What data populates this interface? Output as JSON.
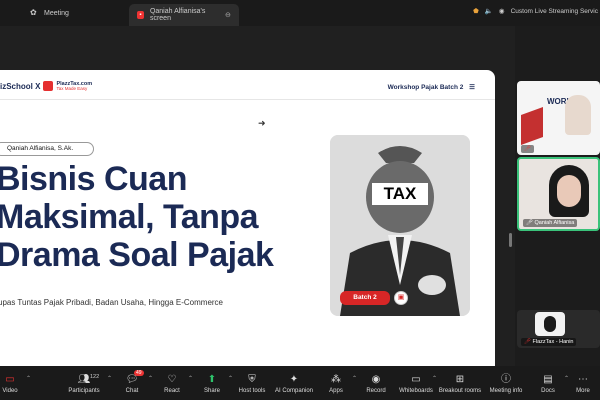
{
  "window": {
    "tabs": [
      {
        "label": "Meeting"
      },
      {
        "label": "Qaniah Alfianisa's screen"
      }
    ],
    "streaming_label": "Custom Live Streaming Servic"
  },
  "slide": {
    "brand": "izSchool X",
    "brand_partner": "PlazzTax.com",
    "brand_tagline": "Tax Made Easy",
    "workshop_label": "Workshop Pajak Batch 2",
    "speaker": "Qaniah Alfianisa, S.Ak.",
    "headline": [
      "Bisnis Cuan",
      "Maksimal, Tanpa",
      "Drama Soal Pajak"
    ],
    "tagline": "upas Tuntas Pajak Pribadi, Badan Usaha, Hingga E-Commerce",
    "tax_bag_label": "TAX",
    "batch_label": "Batch 2"
  },
  "participants_panel": {
    "tiles": [
      {
        "name": "",
        "top_label": "WORK"
      },
      {
        "name": "Qaniah Alfianisa"
      },
      {
        "name": "FlazzTax - Hanin"
      }
    ]
  },
  "toolbar": {
    "items": [
      {
        "label": "Video",
        "icon": "video-off-icon"
      },
      {
        "label": "Participants",
        "icon": "participants-icon",
        "count": "122"
      },
      {
        "label": "Chat",
        "icon": "chat-icon",
        "badge": "49"
      },
      {
        "label": "React",
        "icon": "react-icon"
      },
      {
        "label": "Share",
        "icon": "share-icon"
      },
      {
        "label": "Host tools",
        "icon": "shield-icon"
      },
      {
        "label": "AI Companion",
        "icon": "sparkle-icon"
      },
      {
        "label": "Apps",
        "icon": "apps-icon"
      },
      {
        "label": "Record",
        "icon": "record-icon"
      },
      {
        "label": "Whiteboards",
        "icon": "whiteboard-icon"
      },
      {
        "label": "Breakout rooms",
        "icon": "breakout-icon"
      },
      {
        "label": "Meeting info",
        "icon": "info-icon"
      },
      {
        "label": "Docs",
        "icon": "docs-icon"
      },
      {
        "label": "More",
        "icon": "more-icon"
      }
    ]
  },
  "colors": {
    "accent_red": "#d72626",
    "navy": "#1b2a55",
    "share_green": "#2ec26b"
  }
}
